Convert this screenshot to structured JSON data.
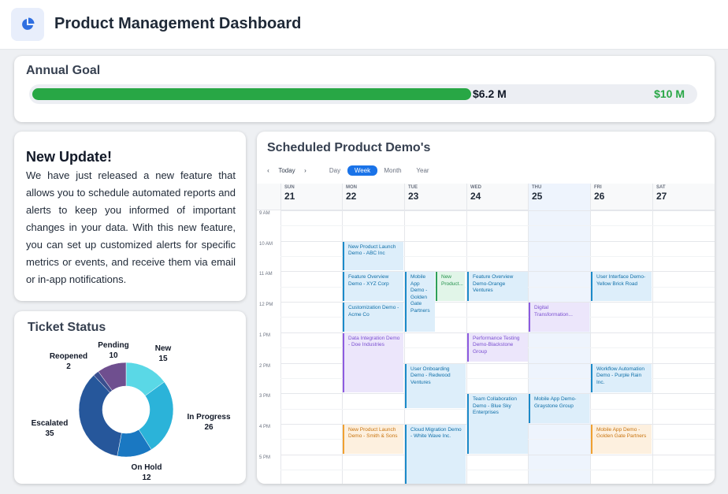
{
  "header": {
    "title": "Product Management Dashboard",
    "logo_icon": "pie-chart-icon"
  },
  "annual_goal": {
    "title": "Annual Goal",
    "current_label": "$6.2 M",
    "target_label": "$10 M",
    "progress": 0.62,
    "color": "#28a745"
  },
  "update": {
    "title": "New Update!",
    "body": "We have just released a new feature that allows you to schedule automated reports and alerts to keep you informed of important changes in your data. With this new feature, you can set up customized alerts for specific metrics or events, and receive them via email or in-app notifications."
  },
  "ticket_status": {
    "title": "Ticket Status",
    "chart_data": {
      "type": "pie",
      "categories": [
        "New",
        "In Progress",
        "On Hold",
        "Escalated",
        "Reopened",
        "Pending"
      ],
      "values": [
        15,
        26,
        12,
        35,
        2,
        10
      ],
      "colors": [
        "#5ad8e6",
        "#2bb3d9",
        "#1a78c2",
        "#26579b",
        "#3a4f8f",
        "#6f4f8f"
      ]
    }
  },
  "demos": {
    "title": "Scheduled Product Demo's",
    "nav": {
      "prev": "‹",
      "today": "Today",
      "next": "›"
    },
    "views": [
      "Day",
      "Week",
      "Month",
      "Year"
    ],
    "active_view": "Week",
    "days": [
      {
        "name": "SUN",
        "num": "21"
      },
      {
        "name": "MON",
        "num": "22"
      },
      {
        "name": "TUE",
        "num": "23"
      },
      {
        "name": "WED",
        "num": "24"
      },
      {
        "name": "THU",
        "num": "25"
      },
      {
        "name": "FRI",
        "num": "26"
      },
      {
        "name": "SAT",
        "num": "27"
      }
    ],
    "today_index": 4,
    "hours": [
      "9 AM",
      "10 AM",
      "11 AM",
      "12 PM",
      "1 PM",
      "2 PM",
      "3 PM",
      "4 PM",
      "5 PM"
    ],
    "events": [
      {
        "title": "New Product Launch Demo - ABC Inc",
        "day": 1,
        "start": 10.0,
        "end": 11.0,
        "color": "blue"
      },
      {
        "title": "Feature Overview Demo - XYZ Corp",
        "day": 1,
        "start": 11.0,
        "end": 12.0,
        "color": "blue"
      },
      {
        "title": "Customization Demo - Acme Co",
        "day": 1,
        "start": 12.0,
        "end": 13.0,
        "color": "blue"
      },
      {
        "title": "Data Integration Demo - Doe Industries",
        "day": 1,
        "start": 13.0,
        "end": 15.0,
        "color": "purple"
      },
      {
        "title": "New Product Launch Demo - Smith & Sons",
        "day": 1,
        "start": 16.0,
        "end": 17.0,
        "color": "orange"
      },
      {
        "title": "Mobile App Demo - Golden Gate Partners",
        "day": 2,
        "start": 11.0,
        "end": 13.0,
        "color": "blue",
        "half": 0
      },
      {
        "title": "New Product...",
        "day": 2,
        "start": 11.0,
        "end": 12.0,
        "color": "green",
        "half": 1
      },
      {
        "title": "User Onboarding Demo - Redwood Ventures",
        "day": 2,
        "start": 14.0,
        "end": 15.5,
        "color": "blue"
      },
      {
        "title": "Cloud Migration Demo - White Wave Inc.",
        "day": 2,
        "start": 16.0,
        "end": 18.0,
        "color": "blue"
      },
      {
        "title": "Feature Overview Demo-Orange Ventures",
        "day": 3,
        "start": 11.0,
        "end": 12.0,
        "color": "blue"
      },
      {
        "title": "Performance Testing Demo-Blackstone Group",
        "day": 3,
        "start": 13.0,
        "end": 14.0,
        "color": "purple"
      },
      {
        "title": "Team Collaboration Demo - Blue Sky Enterprises",
        "day": 3,
        "start": 15.0,
        "end": 17.0,
        "color": "blue"
      },
      {
        "title": "Digital Transformation...",
        "day": 4,
        "start": 12.0,
        "end": 13.0,
        "color": "purple"
      },
      {
        "title": "Mobile App Demo-Graystone Group",
        "day": 4,
        "start": 15.0,
        "end": 16.0,
        "color": "blue"
      },
      {
        "title": "User Interface Demo-Yellow Brick Road",
        "day": 5,
        "start": 11.0,
        "end": 12.0,
        "color": "blue"
      },
      {
        "title": "Workflow Automation Demo - Purple Rain Inc.",
        "day": 5,
        "start": 14.0,
        "end": 15.0,
        "color": "blue"
      },
      {
        "title": "Mobile App Demo - Golden Gate Partners",
        "day": 5,
        "start": 16.0,
        "end": 17.0,
        "color": "orange"
      }
    ]
  }
}
